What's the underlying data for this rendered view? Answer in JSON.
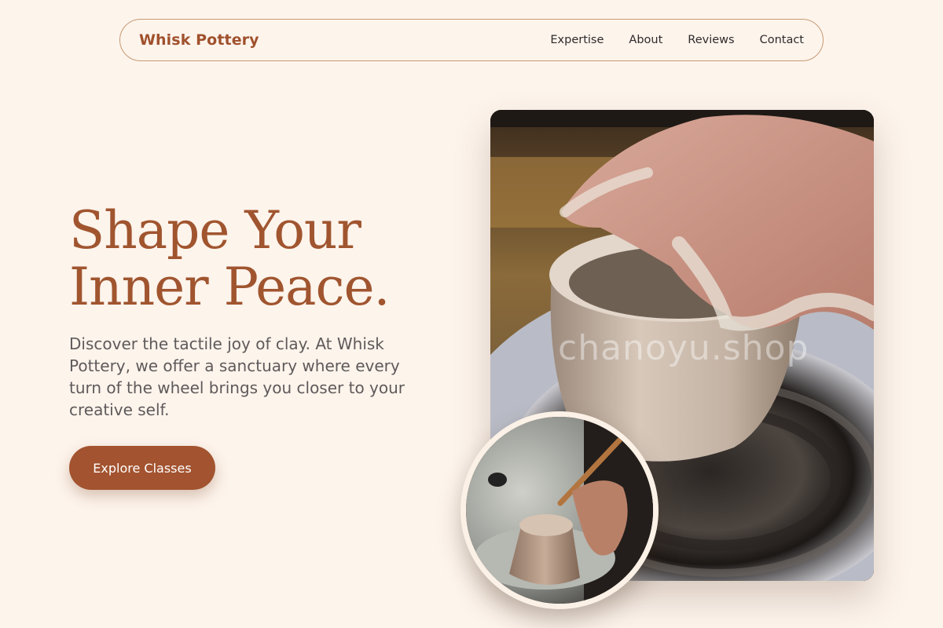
{
  "header": {
    "brand": "Whisk Pottery",
    "nav": [
      {
        "label": "Expertise"
      },
      {
        "label": "About"
      },
      {
        "label": "Reviews"
      },
      {
        "label": "Contact"
      }
    ]
  },
  "hero": {
    "title_line1": "Shape Your",
    "title_line2": "Inner Peace.",
    "description": "Discover the tactile joy of clay. At Whisk Pottery, we offer a sanctuary where every turn of the wheel brings you closer to your creative self.",
    "cta_label": "Explore Classes"
  },
  "images": {
    "main_watermark": "chanoyu.shop"
  },
  "colors": {
    "background": "#fdf4ec",
    "brand": "#a0512d",
    "cta": "#a3532f",
    "nav_border": "#c79a73"
  },
  "icons": {
    "main_image": "pottery-wheel-hands-image",
    "circle_image": "pottery-carving-tool-image"
  }
}
